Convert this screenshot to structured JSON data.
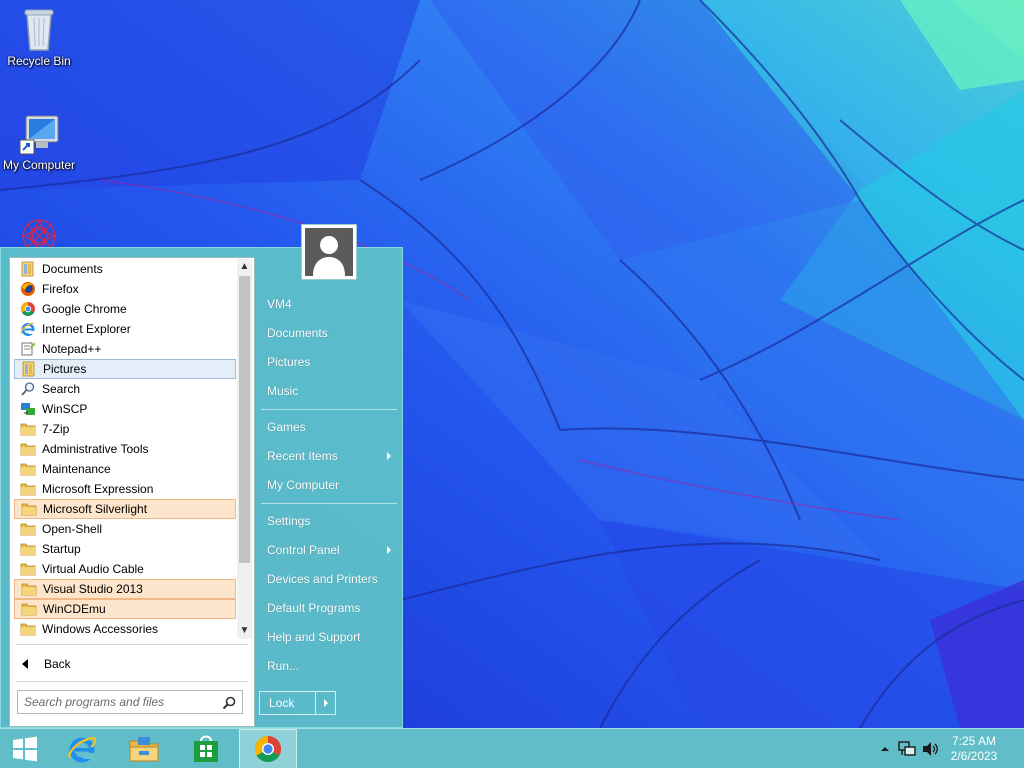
{
  "desktop": {
    "icons": [
      {
        "label": "Recycle Bin",
        "icon": "recycle-bin-icon"
      },
      {
        "label": "My Computer",
        "icon": "computer-icon"
      },
      {
        "label": "",
        "icon": "mandala-icon"
      }
    ]
  },
  "start_menu": {
    "programs": [
      {
        "label": "Documents",
        "icon": "library-icon",
        "state": "normal"
      },
      {
        "label": "Firefox",
        "icon": "firefox-icon",
        "state": "normal"
      },
      {
        "label": "Google Chrome",
        "icon": "chrome-icon",
        "state": "normal"
      },
      {
        "label": "Internet Explorer",
        "icon": "ie-icon",
        "state": "normal"
      },
      {
        "label": "Notepad++",
        "icon": "notepadpp-icon",
        "state": "normal"
      },
      {
        "label": "Pictures",
        "icon": "library-icon",
        "state": "selected"
      },
      {
        "label": "Search",
        "icon": "search-icon",
        "state": "normal"
      },
      {
        "label": "WinSCP",
        "icon": "winscp-icon",
        "state": "normal"
      },
      {
        "label": "7-Zip",
        "icon": "folder-icon",
        "state": "normal"
      },
      {
        "label": "Administrative Tools",
        "icon": "folder-icon",
        "state": "normal"
      },
      {
        "label": "Maintenance",
        "icon": "folder-icon",
        "state": "normal"
      },
      {
        "label": "Microsoft Expression",
        "icon": "folder-icon",
        "state": "normal"
      },
      {
        "label": "Microsoft Silverlight",
        "icon": "folder-icon",
        "state": "highlight"
      },
      {
        "label": "Open-Shell",
        "icon": "folder-icon",
        "state": "normal"
      },
      {
        "label": "Startup",
        "icon": "folder-icon",
        "state": "normal"
      },
      {
        "label": "Virtual Audio Cable",
        "icon": "folder-icon",
        "state": "normal"
      },
      {
        "label": "Visual Studio 2013",
        "icon": "folder-icon",
        "state": "highlight"
      },
      {
        "label": "WinCDEmu",
        "icon": "folder-icon",
        "state": "highlight"
      },
      {
        "label": "Windows Accessories",
        "icon": "folder-icon",
        "state": "normal"
      }
    ],
    "back_label": "Back",
    "search_placeholder": "Search programs and files",
    "right_items": [
      {
        "label": "VM4",
        "has_submenu": false
      },
      {
        "label": "Documents",
        "has_submenu": false
      },
      {
        "label": "Pictures",
        "has_submenu": false
      },
      {
        "label": "Music",
        "has_submenu": false
      },
      {
        "label": "Games",
        "has_submenu": false
      },
      {
        "label": "Recent Items",
        "has_submenu": true
      },
      {
        "label": "My Computer",
        "has_submenu": false
      },
      {
        "label": "Settings",
        "has_submenu": false
      },
      {
        "label": "Control Panel",
        "has_submenu": true
      },
      {
        "label": "Devices and Printers",
        "has_submenu": false
      },
      {
        "label": "Default Programs",
        "has_submenu": false
      },
      {
        "label": "Help and Support",
        "has_submenu": false
      },
      {
        "label": "Run...",
        "has_submenu": false
      }
    ],
    "lock_label": "Lock"
  },
  "taskbar": {
    "buttons": [
      {
        "icon": "windows-start-icon",
        "active": false
      },
      {
        "icon": "ie-icon",
        "active": false
      },
      {
        "icon": "file-explorer-icon",
        "active": false
      },
      {
        "icon": "store-icon",
        "active": false
      },
      {
        "icon": "chrome-icon",
        "active": true
      }
    ],
    "clock_time": "7:25 AM",
    "clock_date": "2/6/2023"
  },
  "colors": {
    "start_menu_bg": "#60c4c8",
    "highlight": "#fde5cb",
    "selected": "#e3eef9"
  }
}
